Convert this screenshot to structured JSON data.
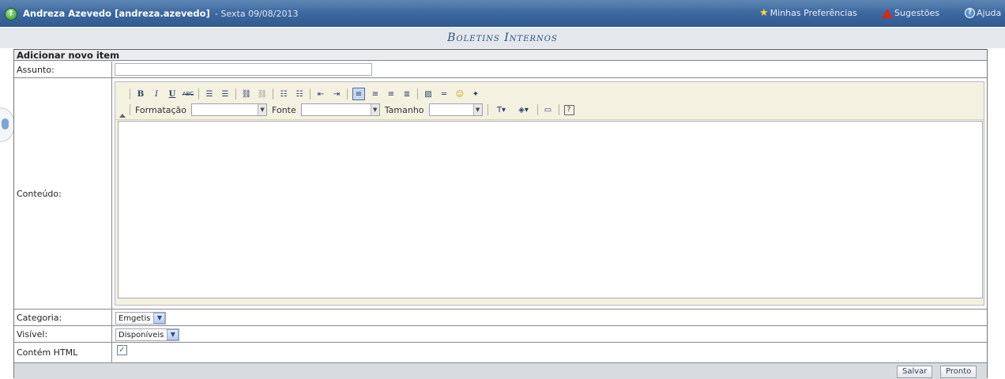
{
  "topbar": {
    "user": "Andreza Azevedo [andreza.azevedo]",
    "date": "- Sexta 09/08/2013",
    "links": {
      "preferences": "Minhas Preferências",
      "suggestions": "Sugestões",
      "help": "Ajuda"
    }
  },
  "section_title": "Boletins Internos",
  "form": {
    "header": "Adicionar novo item",
    "subject_label": "Assunto:",
    "subject_value": "",
    "content_label": "Conteúdo:",
    "category_label": "Categoria:",
    "category_value": "Emgetis",
    "visible_label": "Visível:",
    "visible_value": "Disponíveis",
    "html_label": "Contém HTML",
    "html_checked": true
  },
  "editor": {
    "format_label": "Formatação",
    "font_label": "Fonte",
    "size_label": "Tamanho",
    "format_buttons": [
      "B",
      "I",
      "U",
      "ABC"
    ]
  },
  "buttons": {
    "save": "Salvar",
    "done": "Pronto"
  },
  "colors": {
    "topbar": "#3e6aa0",
    "title_text": "#2d4f7e"
  }
}
